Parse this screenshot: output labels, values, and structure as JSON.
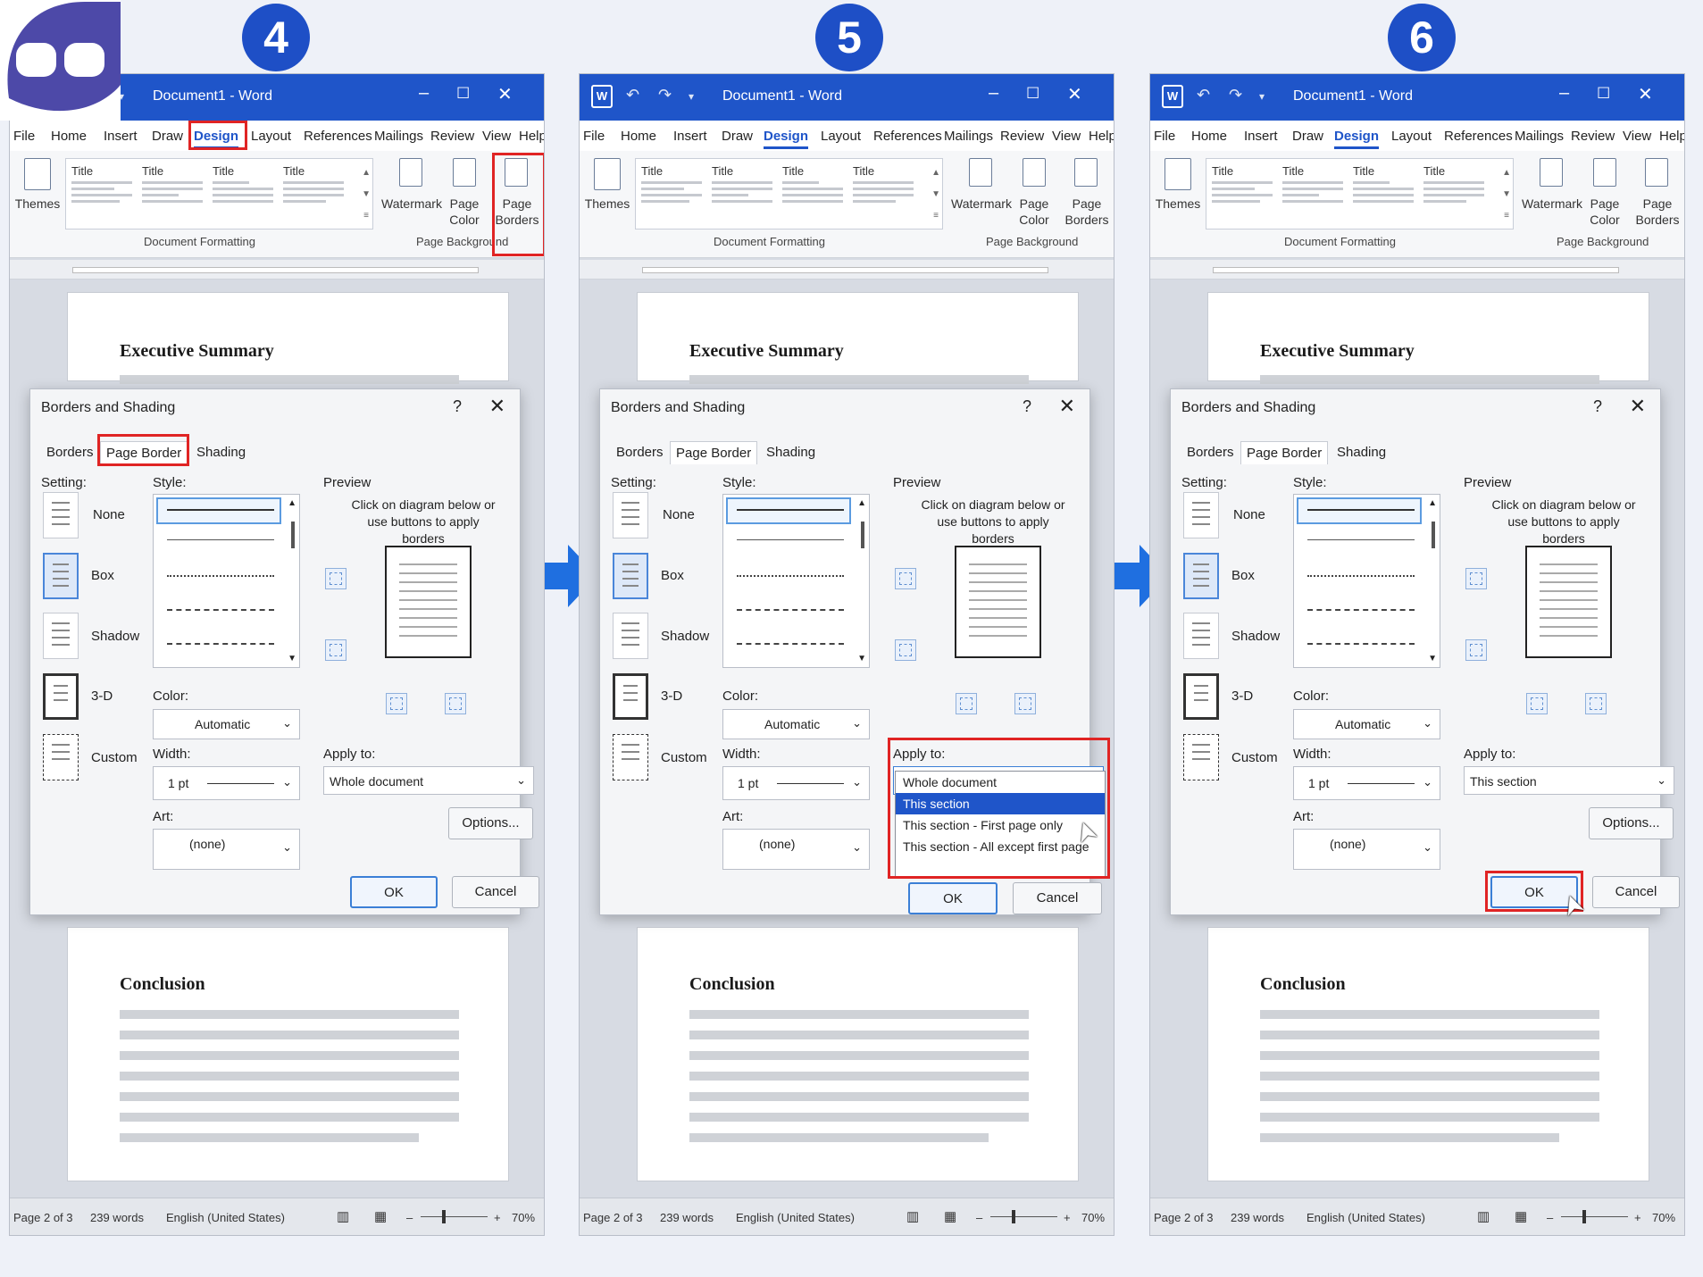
{
  "steps": [
    "4",
    "5",
    "6"
  ],
  "title": "Document1 - Word",
  "menu": [
    "File",
    "Home",
    "Insert",
    "Draw",
    "Design",
    "Layout",
    "References",
    "Mailings",
    "Review",
    "View",
    "Help"
  ],
  "ribbon": {
    "themes": "Themes",
    "style_title": "Title",
    "watermark": "Watermark",
    "page_color": "Page\nColor",
    "page_borders": "Page\nBorders",
    "group_doc_formatting": "Document Formatting",
    "group_page_background": "Page Background"
  },
  "doc": {
    "heading1": "Executive Summary",
    "heading2": "Conclusion"
  },
  "dialog": {
    "title": "Borders and Shading",
    "help": "?",
    "close": "✕",
    "tabs": [
      "Borders",
      "Page Border",
      "Shading"
    ],
    "setting_label": "Setting:",
    "settings": [
      "None",
      "Box",
      "Shadow",
      "3-D",
      "Custom"
    ],
    "style_label": "Style:",
    "color_label": "Color:",
    "color_value": "Automatic",
    "width_label": "Width:",
    "width_value": "1 pt",
    "art_label": "Art:",
    "art_value": "(none)",
    "preview_label": "Preview",
    "preview_hint": "Click on diagram below or use buttons to apply borders",
    "apply_label": "Apply to:",
    "options": "Options...",
    "ok": "OK",
    "cancel": "Cancel"
  },
  "panels": [
    {
      "apply_value": "Whole document"
    },
    {
      "apply_value": "This section"
    },
    {
      "apply_value": "This section"
    }
  ],
  "apply_options": [
    "Whole document",
    "This section",
    "This section - First page only",
    "This section - All except first page"
  ],
  "status": {
    "page": "Page 2 of 3",
    "words": "239 words",
    "lang": "English (United States)",
    "zoom": "70%"
  },
  "colors": {
    "accent": "#1f55c9",
    "highlight": "#e02424",
    "logo": "#4d49a8"
  }
}
